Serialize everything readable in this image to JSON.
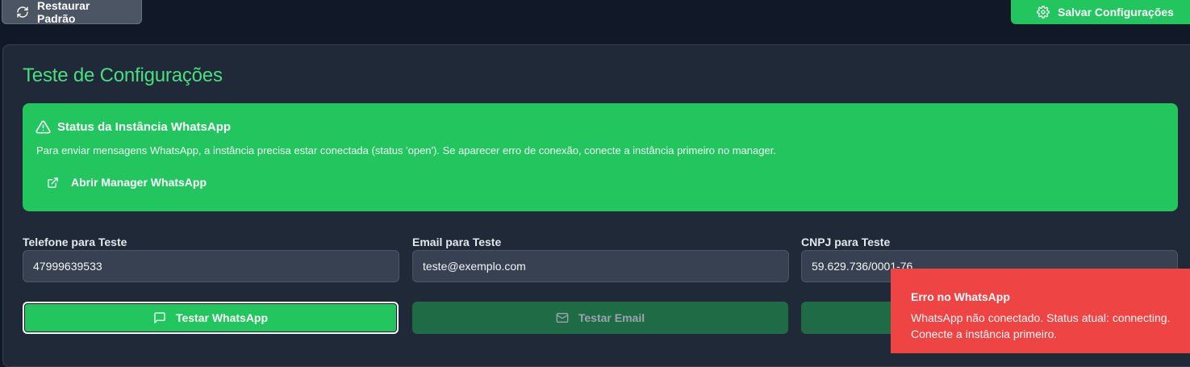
{
  "header": {
    "restore_label": "Restaurar Padrão",
    "save_label": "Salvar Configurações"
  },
  "card": {
    "title": "Teste de Configurações"
  },
  "alert": {
    "title": "Status da Instância WhatsApp",
    "description": "Para enviar mensagens WhatsApp, a instância precisa estar conectada (status 'open'). Se aparecer erro de conexão, conecte a instância primeiro no manager.",
    "link_label": "Abrir Manager WhatsApp"
  },
  "fields": {
    "phone": {
      "label": "Telefone para Teste",
      "value": "47999639533"
    },
    "email": {
      "label": "Email para Teste",
      "value": "teste@exemplo.com"
    },
    "cnpj": {
      "label": "CNPJ para Teste",
      "value": "59.629.736/0001-76"
    }
  },
  "actions": {
    "whatsapp_label": "Testar WhatsApp",
    "email_label": "Testar Email"
  },
  "toast": {
    "title": "Erro no WhatsApp",
    "message_line1": "WhatsApp não conectado. Status atual: connecting.",
    "message_line2": "Conecte a instância primeiro."
  },
  "colors": {
    "background": "#111827",
    "card": "#1f2937",
    "accent_green": "#22c55e",
    "title_green": "#4ade80",
    "error_red": "#ef4444"
  },
  "icons": {
    "restore": "refresh-icon",
    "save": "gear-icon",
    "alert": "warning-triangle-icon",
    "link": "external-link-icon",
    "whatsapp": "message-square-icon",
    "email": "mail-icon"
  }
}
